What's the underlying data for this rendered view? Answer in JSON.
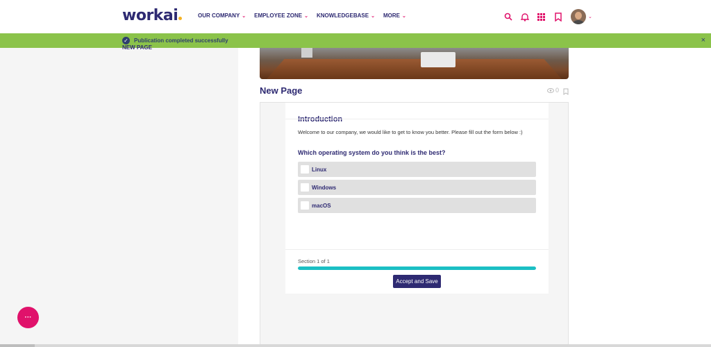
{
  "brand": {
    "logo_text": "workai",
    "accent": "#e0126b",
    "primary": "#2e2a72",
    "success": "#8bc34a"
  },
  "nav": {
    "items": [
      {
        "label": "OUR COMPANY"
      },
      {
        "label": "EMPLOYEE ZONE"
      },
      {
        "label": "KNOWLEDGEBASE"
      },
      {
        "label": "MORE"
      }
    ],
    "icons": [
      "search-icon",
      "bell-icon",
      "apps-grid-icon",
      "bookmark-icon",
      "avatar"
    ]
  },
  "banner": {
    "message": "Publication completed successfully",
    "close": "×"
  },
  "sidebar": {
    "item_label": "NEW PAGE"
  },
  "page": {
    "title": "New Page",
    "views": "0"
  },
  "form": {
    "section_title": "Introduction",
    "welcome": "Welcome to our company, we would like to get to know you better. Please fill out the form below :)",
    "question": "Which operating system do you think is the best?",
    "options": [
      {
        "label": "Linux",
        "checked": false
      },
      {
        "label": "Windows",
        "checked": false
      },
      {
        "label": "macOS",
        "checked": false
      }
    ],
    "section_progress_text": "Section 1 of 1",
    "progress_percent": 100,
    "submit_label": "Accept and Save"
  },
  "fab": {
    "label": "···"
  }
}
